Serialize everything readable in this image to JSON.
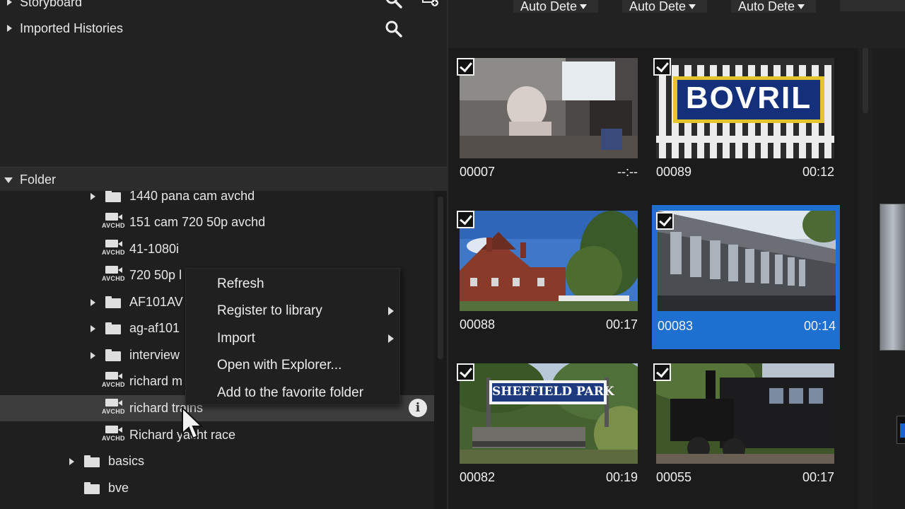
{
  "top_tree": {
    "storyboard_label": "Storyboard",
    "imported_histories_label": "Imported Histories"
  },
  "folder_panel": {
    "header_label": "Folder",
    "items": [
      {
        "label": "1440 pana cam avchd",
        "type": "folder",
        "expandable": true
      },
      {
        "label": "151 cam 720 50p avchd",
        "type": "avchd",
        "expandable": false
      },
      {
        "label": "41-1080i",
        "type": "avchd",
        "expandable": false
      },
      {
        "label": "720 50p l",
        "type": "avchd",
        "expandable": false
      },
      {
        "label": "AF101AV",
        "type": "folder",
        "expandable": true
      },
      {
        "label": "ag-af101",
        "type": "folder",
        "expandable": true
      },
      {
        "label": "interview",
        "type": "folder",
        "expandable": true
      },
      {
        "label": "richard m",
        "type": "avchd",
        "expandable": false
      },
      {
        "label": "richard trains",
        "type": "avchd",
        "expandable": false,
        "highlighted": true
      },
      {
        "label": "Richard yacht race",
        "type": "avchd",
        "expandable": false
      },
      {
        "label": "basics",
        "type": "folder",
        "expandable": true
      },
      {
        "label": "bve",
        "type": "folder",
        "expandable": false
      }
    ],
    "icon_text": "AVCHD",
    "info_glyph": "i"
  },
  "context_menu": {
    "items": [
      {
        "label": "Refresh",
        "submenu": false
      },
      {
        "label": "Register to library",
        "submenu": true
      },
      {
        "label": "Import",
        "submenu": true
      },
      {
        "label": "Open with Explorer...",
        "submenu": false
      },
      {
        "label": "Add to the favorite folder",
        "submenu": false
      }
    ]
  },
  "toolbar": {
    "dropdowns": [
      "Auto Dete",
      "Auto Dete",
      "Auto Dete"
    ]
  },
  "clips": [
    {
      "name": "00007",
      "duration": "--:--",
      "checked": true,
      "selected": false
    },
    {
      "name": "00089",
      "duration": "00:12",
      "checked": true,
      "selected": false,
      "sign_text": "BOVRIL"
    },
    {
      "name": "00088",
      "duration": "00:17",
      "checked": true,
      "selected": false
    },
    {
      "name": "00083",
      "duration": "00:14",
      "checked": true,
      "selected": true
    },
    {
      "name": "00082",
      "duration": "00:19",
      "checked": true,
      "selected": false,
      "sign_text": "SHEFFIELD PARK"
    },
    {
      "name": "00055",
      "duration": "00:17",
      "checked": true,
      "selected": false
    }
  ],
  "colors": {
    "selection": "#1d6fd0",
    "panel": "#232323",
    "background": "#1b1b1b"
  }
}
